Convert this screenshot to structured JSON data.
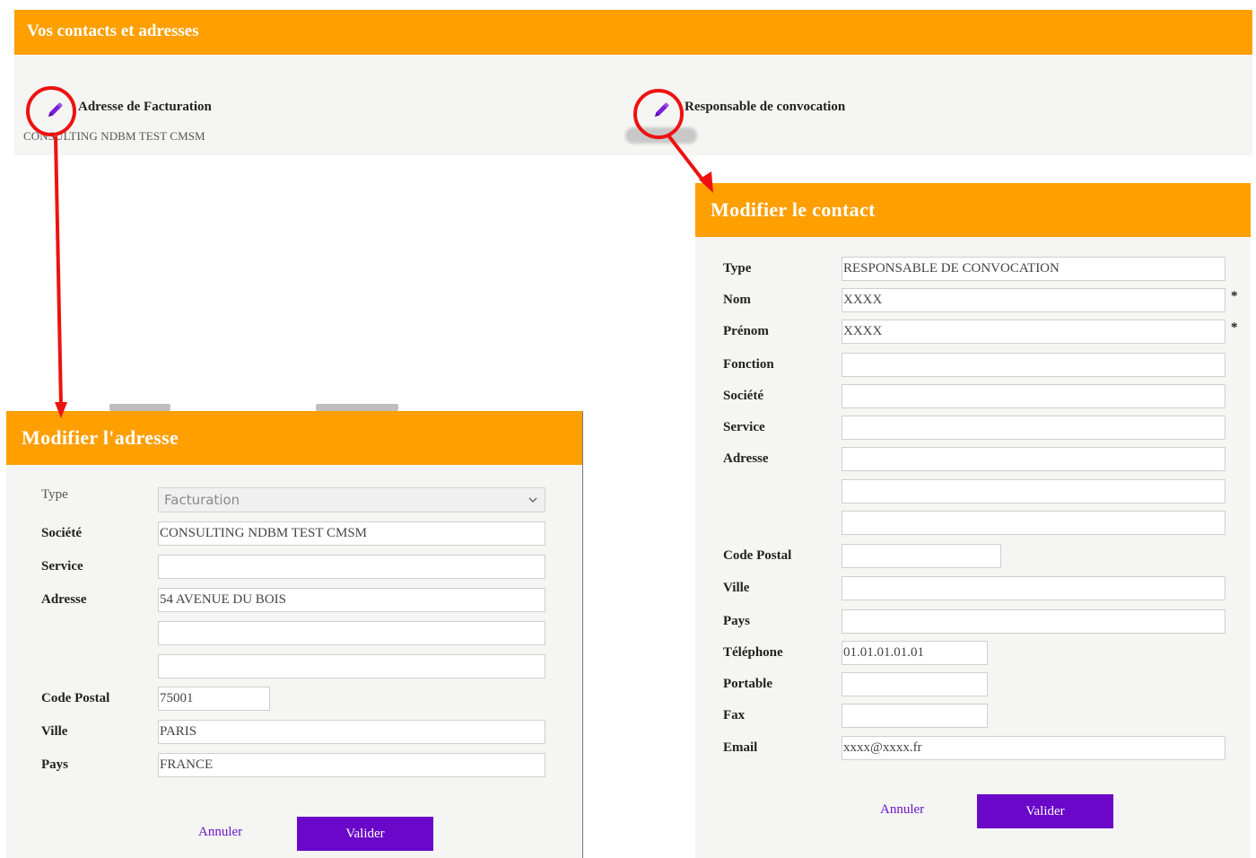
{
  "header": {
    "title": "Vos contacts et adresses"
  },
  "cards": {
    "billing": {
      "title": "Adresse de Facturation",
      "subtitle": "CONSULTING NDBM TEST CMSM"
    },
    "convocation": {
      "title": "Responsable de convocation"
    }
  },
  "address_modal": {
    "title": "Modifier l'adresse",
    "labels": {
      "type": "Type",
      "societe": "Société",
      "service": "Service",
      "adresse": "Adresse",
      "code_postal": "Code Postal",
      "ville": "Ville",
      "pays": "Pays"
    },
    "values": {
      "type": "Facturation",
      "societe": "CONSULTING NDBM TEST CMSM",
      "service": "",
      "adresse1": "54 AVENUE DU BOIS",
      "adresse2": "",
      "adresse3": "",
      "code_postal": "75001",
      "ville": "PARIS",
      "pays": "FRANCE"
    },
    "cancel_label": "Annuler",
    "submit_label": "Valider"
  },
  "contact_modal": {
    "title": "Modifier le contact",
    "labels": {
      "type": "Type",
      "nom": "Nom",
      "prenom": "Prénom",
      "fonction": "Fonction",
      "societe": "Société",
      "service": "Service",
      "adresse": "Adresse",
      "code_postal": "Code Postal",
      "ville": "Ville",
      "pays": "Pays",
      "telephone": "Téléphone",
      "portable": "Portable",
      "fax": "Fax",
      "email": "Email"
    },
    "values": {
      "type": "RESPONSABLE DE CONVOCATION",
      "nom": "XXXX",
      "prenom": "XXXX",
      "fonction": "",
      "societe": "",
      "service": "",
      "adresse1": "",
      "adresse2": "",
      "adresse3": "",
      "code_postal": "",
      "ville": "",
      "pays": "",
      "telephone": "01.01.01.01.01",
      "portable": "",
      "fax": "",
      "email": "xxxx@xxxx.fr"
    },
    "required_mark": "*",
    "cancel_label": "Annuler",
    "submit_label": "Valider"
  },
  "colors": {
    "accent_orange": "#ff9f00",
    "primary_purple": "#6b07c9",
    "annotation_red": "#ee1111",
    "panel_bg": "#f5f5f3"
  },
  "icons": {
    "edit": "pencil-icon",
    "select_arrow": "chevron-down-icon"
  }
}
